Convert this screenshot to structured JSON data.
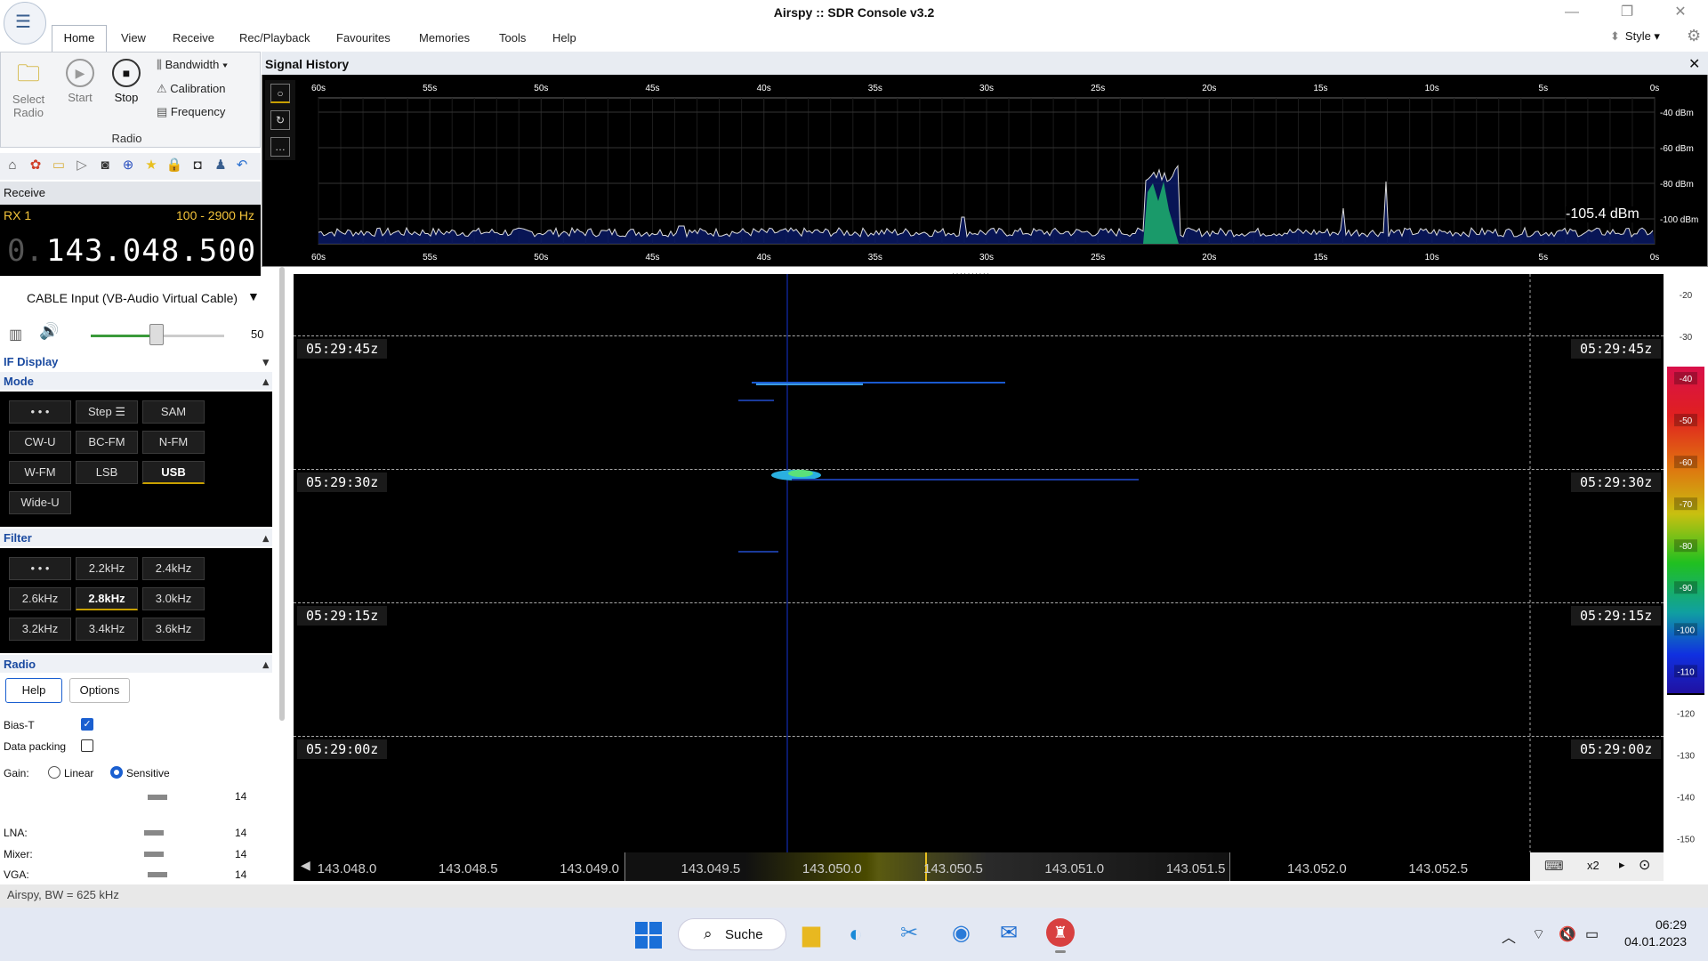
{
  "window": {
    "title": "Airspy :: SDR Console v3.2",
    "style_label": "Style"
  },
  "menu": [
    "Home",
    "View",
    "Receive",
    "Rec/Playback",
    "Favourites",
    "Memories",
    "Tools",
    "Help"
  ],
  "ribbon": {
    "select_radio": "Select Radio",
    "start": "Start",
    "stop": "Stop",
    "bandwidth": "Bandwidth",
    "calibration": "Calibration",
    "frequency": "Frequency",
    "group_label": "Radio"
  },
  "receive": {
    "label": "Receive",
    "rx_name": "RX 1",
    "rx_range": "100 - 2900 Hz",
    "freq_prefix": "0.",
    "frequency": "143.048.500"
  },
  "audio": {
    "input": "CABLE Input (VB-Audio Virtual Cable)",
    "volume": "50",
    "volume_level": 0.48
  },
  "sections": {
    "if_display": "IF Display",
    "mode": "Mode",
    "filter": "Filter",
    "radio": "Radio"
  },
  "mode_buttons": [
    "• • •",
    "Step ☰",
    "SAM",
    "CW-U",
    "BC-FM",
    "N-FM",
    "W-FM",
    "LSB",
    "USB",
    "Wide-U"
  ],
  "mode_selected": "USB",
  "filter_buttons": [
    "• • •",
    "2.2kHz",
    "2.4kHz",
    "2.6kHz",
    "2.8kHz",
    "3.0kHz",
    "3.2kHz",
    "3.4kHz",
    "3.6kHz"
  ],
  "filter_selected": "2.8kHz",
  "radio": {
    "help": "Help",
    "options": "Options",
    "bias_t": "Bias-T",
    "bias_t_checked": true,
    "data_packing": "Data packing",
    "data_packing_checked": false,
    "gain_label": "Gain:",
    "gain_linear": "Linear",
    "gain_sensitive": "Sensitive",
    "gain_value": "14",
    "lna": "LNA:",
    "lna_value": "14",
    "mixer": "Mixer:",
    "mixer_value": "14",
    "vga": "VGA:",
    "vga_value": "14"
  },
  "signal_history": {
    "title": "Signal History",
    "time_ticks": [
      "60s",
      "55s",
      "50s",
      "45s",
      "40s",
      "35s",
      "30s",
      "25s",
      "20s",
      "15s",
      "10s",
      "5s",
      "0s"
    ],
    "db_ticks": [
      "-40 dBm",
      "-60 dBm",
      "-80 dBm",
      "-100 dBm"
    ],
    "current_level": "-105.4 dBm"
  },
  "waterfall": {
    "timestamps": [
      "05:29:45z",
      "05:29:30z",
      "05:29:15z",
      "05:29:00z"
    ]
  },
  "colorbar": {
    "ticks": [
      "-20",
      "-30",
      "-40",
      "-50",
      "-60",
      "-70",
      "-80",
      "-90",
      "-100",
      "-110",
      "-120",
      "-130",
      "-140",
      "-150"
    ]
  },
  "freq_scale": {
    "labels": [
      "143.048.0",
      "143.048.5",
      "143.049.0",
      "143.049.5",
      "143.050.0",
      "143.050.5",
      "143.051.0",
      "143.051.5",
      "143.052.0",
      "143.052.5"
    ],
    "zoom": "x2"
  },
  "status": {
    "text": "Airspy, BW = 625 kHz"
  },
  "taskbar": {
    "search": "Suche",
    "time": "06:29",
    "date": "04.01.2023"
  },
  "colors": {
    "accent_yellow": "#f3c33a",
    "link_blue": "#1a4aa0",
    "select_blue": "#1a5fd0"
  }
}
